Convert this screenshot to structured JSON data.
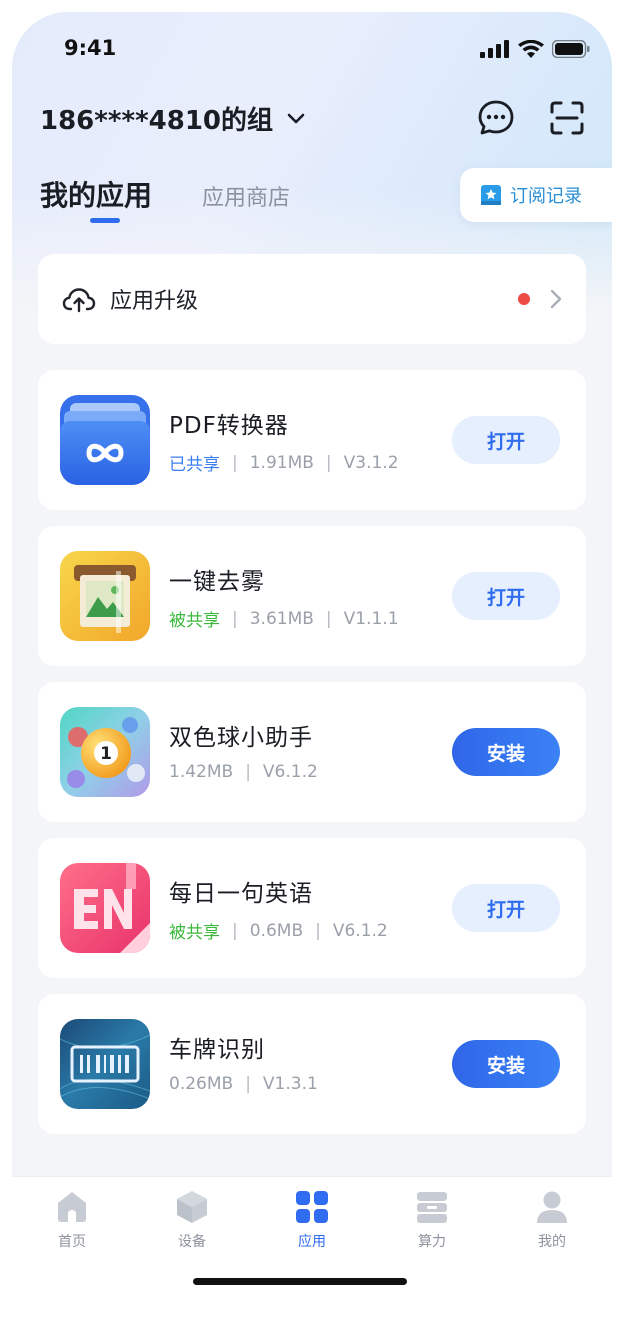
{
  "status_bar": {
    "time": "9:41"
  },
  "header": {
    "group_name": "186****4810的组"
  },
  "tabs": {
    "active": "我的应用",
    "inactive": "应用商店"
  },
  "subscription": {
    "label": "订阅记录"
  },
  "upgrade": {
    "label": "应用升级"
  },
  "apps": [
    {
      "name": "PDF转换器",
      "shared": "已共享",
      "size": "1.91MB",
      "version": "V3.1.2",
      "action": "打开"
    },
    {
      "name": "一键去雾",
      "shared": "被共享",
      "size": "3.61MB",
      "version": "V1.1.1",
      "action": "打开"
    },
    {
      "name": "双色球小助手",
      "size": "1.42MB",
      "version": "V6.1.2",
      "action": "安装"
    },
    {
      "name": "每日一句英语",
      "shared": "被共享",
      "size": "0.6MB",
      "version": "V6.1.2",
      "action": "打开"
    },
    {
      "name": "车牌识别",
      "size": "0.26MB",
      "version": "V1.3.1",
      "action": "安装"
    }
  ],
  "nav": [
    {
      "label": "首页",
      "icon": "home-icon"
    },
    {
      "label": "设备",
      "icon": "device-cube-icon"
    },
    {
      "label": "应用",
      "icon": "apps-grid-icon"
    },
    {
      "label": "算力",
      "icon": "compute-server-icon"
    },
    {
      "label": "我的",
      "icon": "profile-icon"
    }
  ],
  "colors": {
    "accent": "#2f6cf0",
    "shared_blue": "#3c7ef0",
    "shared_green": "#3cb83c",
    "badge_red": "#ee4a46"
  }
}
